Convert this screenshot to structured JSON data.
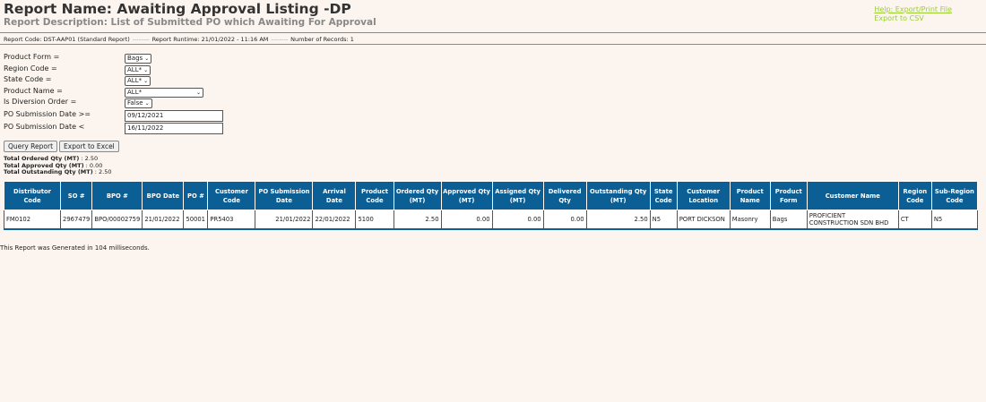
{
  "header": {
    "title": "Report Name: Awaiting Approval Listing -DP",
    "subtitle": "Report Description: List of Submitted PO which Awaiting For Approval"
  },
  "links": {
    "help": "Help: Export/Print File",
    "csv": "Export to CSV"
  },
  "meta": {
    "code": "Report Code: DST-AAP01 (Standard Report)",
    "runtime": "Report Runtime: 21/01/2022 - 11:16 AM",
    "records": "Number of Records: 1",
    "separator": "--------"
  },
  "filters": {
    "product_form": {
      "label": "Product Form =",
      "value": "Bags"
    },
    "region_code": {
      "label": "Region Code =",
      "value": "ALL*"
    },
    "state_code": {
      "label": "State Code =",
      "value": "ALL*"
    },
    "product_name": {
      "label": "Product Name =",
      "value": "ALL*"
    },
    "diversion": {
      "label": "Is Diversion Order =",
      "value": "False"
    },
    "date_from": {
      "label": "PO Submission Date >=",
      "value": "09/12/2021"
    },
    "date_to": {
      "label": "PO Submission Date <",
      "value": "16/11/2022"
    }
  },
  "buttons": {
    "query": "Query Report",
    "excel": "Export to Excel"
  },
  "totals": {
    "ordered_label": "Total Ordered Qty (MT)",
    "ordered_value": ": 2.50",
    "approved_label": "Total Approved Qty (MT)",
    "approved_value": ": 0.00",
    "outstanding_label": "Total Outstanding Qty (MT)",
    "outstanding_value": ": 2.50"
  },
  "table": {
    "headers": [
      "Distributor Code",
      "SO #",
      "BPO #",
      "BPO Date",
      "PO #",
      "Customer Code",
      "PO Submission Date",
      "Arrival Date",
      "Product Code",
      "Ordered Qty (MT)",
      "Approved Qty (MT)",
      "Assigned Qty (MT)",
      "Delivered Qty",
      "Outstanding Qty (MT)",
      "State Code",
      "Customer Location",
      "Product Name",
      "Product Form",
      "Customer Name",
      "Region Code",
      "Sub-Region Code"
    ],
    "rows": [
      [
        "FM0102",
        "2967479",
        "BPO/00002759",
        "21/01/2022",
        "50001",
        "PR5403",
        "21/01/2022",
        "22/01/2022",
        "5100",
        "2.50",
        "0.00",
        "0.00",
        "0.00",
        "2.50",
        "N5",
        "PORT DICKSON",
        "Masonry",
        "Bags",
        "PROFICIENT CONSTRUCTION SDN BHD",
        "CT",
        "N5"
      ]
    ]
  },
  "footer": "This Report was Generated in 104 milliseconds."
}
